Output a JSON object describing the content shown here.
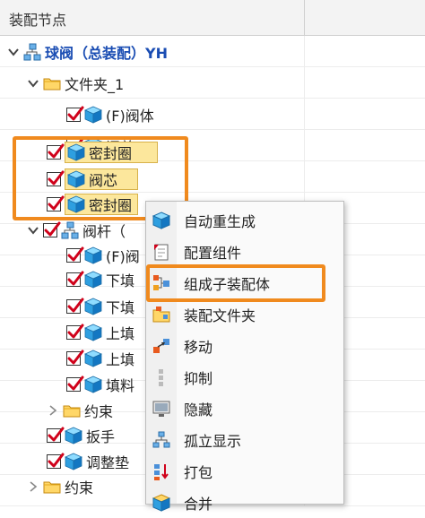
{
  "header": {
    "col1": "装配节点"
  },
  "tree": {
    "root": "球阀（总装配）YH",
    "folder1": "文件夹_1",
    "fa_body": "(F)阀体",
    "valve_cover": "阀盖YH",
    "seal1": "密封圈",
    "valve_core": "阀芯",
    "seal2": "密封圈",
    "valve_stem": "阀杆（",
    "fp_part": "(F)阀",
    "lower_fill1": "下填",
    "lower_fill2": "下填",
    "upper_fill1": "上填",
    "upper_fill2": "上填",
    "packing": "填料",
    "constraint1": "约束",
    "wrench": "扳手",
    "adjust_pad": "调整垫",
    "constraint2": "约束"
  },
  "menu": {
    "items": [
      "自动重生成",
      "配置组件",
      "组成子装配体",
      "装配文件夹",
      "移动",
      "抑制",
      "隐藏",
      "孤立显示",
      "打包",
      "合并"
    ]
  },
  "colors": {
    "highlight": "#fce79c",
    "annotation": "#f08a1e",
    "root_text": "#1a4db3",
    "check": "#d0021b"
  }
}
